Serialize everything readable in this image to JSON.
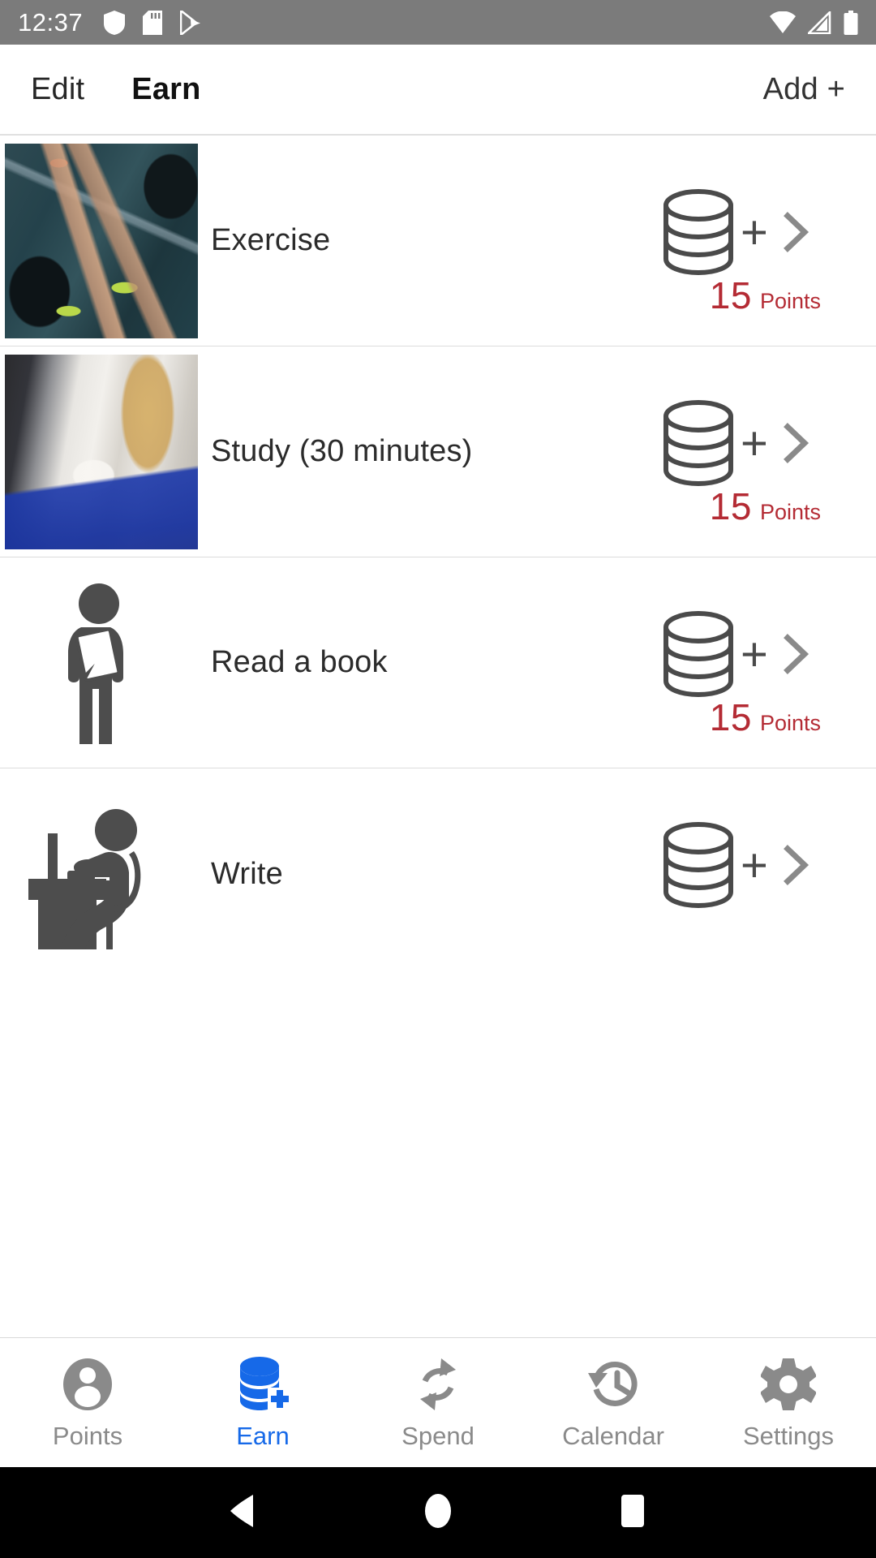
{
  "status_bar": {
    "time": "12:37",
    "left_icons": [
      "shield-icon",
      "sd-card-icon",
      "play-store-icon"
    ],
    "right_icons": [
      "wifi-icon",
      "cellular-signal-icon",
      "battery-icon"
    ],
    "background": "#7b7b7b"
  },
  "app_bar": {
    "edit_label": "Edit",
    "title": "Earn",
    "add_label": "Add +"
  },
  "list": {
    "items": [
      {
        "title": "Exercise",
        "media": "photo-gym",
        "points_value": "15",
        "points_label": "Points",
        "add_icon": "coin-stack-plus-icon",
        "chevron": "chevron-right-icon"
      },
      {
        "title": "Study (30 minutes)",
        "media": "photo-study",
        "points_value": "15",
        "points_label": "Points",
        "add_icon": "coin-stack-plus-icon",
        "chevron": "chevron-right-icon"
      },
      {
        "title": "Read a book",
        "media": "pictogram-person-book",
        "points_value": "15",
        "points_label": "Points",
        "add_icon": "coin-stack-plus-icon",
        "chevron": "chevron-right-icon"
      },
      {
        "title": "Write",
        "media": "pictogram-person-desk",
        "points_value": "",
        "points_label": "",
        "add_icon": "coin-stack-plus-icon",
        "chevron": "chevron-right-icon"
      }
    ]
  },
  "bottom_nav": {
    "active_color": "#1669e8",
    "inactive_color": "#8a8a8a",
    "items": [
      {
        "label": "Points",
        "icon": "account-circle-icon",
        "active": false
      },
      {
        "label": "Earn",
        "icon": "coin-stack-plus-icon",
        "active": true
      },
      {
        "label": "Spend",
        "icon": "sync-arrows-icon",
        "active": false
      },
      {
        "label": "Calendar",
        "icon": "history-clock-icon",
        "active": false
      },
      {
        "label": "Settings",
        "icon": "gear-icon",
        "active": false
      }
    ]
  },
  "system_nav": {
    "back": "back-triangle-icon",
    "home": "home-circle-icon",
    "recents": "recents-square-icon"
  },
  "colors": {
    "points_red": "#b42b34",
    "accent_blue": "#1669e8",
    "status_bar_gray": "#7b7b7b",
    "icon_gray": "#4a4a4a"
  }
}
